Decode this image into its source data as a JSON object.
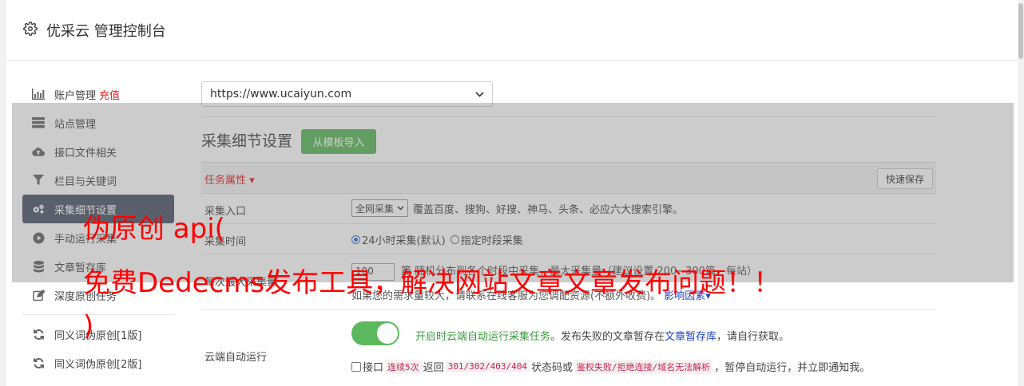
{
  "header": {
    "title": "优采云 管理控制台"
  },
  "sidebar": {
    "items": [
      {
        "label": "账户管理",
        "extra": "充值",
        "icon": "bar-chart-icon"
      },
      {
        "label": "站点管理",
        "icon": "server-icon"
      },
      {
        "label": "接口文件相关",
        "icon": "cloud-upload-icon"
      },
      {
        "label": "栏目与关键词",
        "icon": "filter-icon"
      },
      {
        "label": "采集细节设置",
        "icon": "gears-icon",
        "active": true
      },
      {
        "label": "手动运行采集",
        "icon": "play-circle-icon"
      },
      {
        "label": "文章暂存库",
        "icon": "database-icon"
      },
      {
        "label": "深度原创任务",
        "icon": "edit-icon"
      }
    ],
    "items2": [
      {
        "label": "同义词伪原创[1版]",
        "icon": "refresh-icon"
      },
      {
        "label": "同义词伪原创[2版]",
        "icon": "refresh-icon"
      }
    ]
  },
  "site_select": {
    "value": "https://www.ucaiyun.com"
  },
  "section": {
    "title": "采集细节设置",
    "import_button": "从模板导入"
  },
  "task_props": {
    "label": "任务属性 ▾",
    "save_button": "快速保存"
  },
  "rows": {
    "entry": {
      "label": "采集入口",
      "select": "全网采集",
      "desc": "覆盖百度、搜狗、好搜、神马、头条、必应六大搜索引擎。"
    },
    "time": {
      "label": "采集时间",
      "opt1": "24小时采集(默认)",
      "opt2": "指定时段采集"
    },
    "max": {
      "label": "每次最大采集量",
      "value": "100",
      "line1_unit": "篇",
      "line1_text": "随机分布到各个时段中采集，最大采集量（建议设置 200~300篇，每站）",
      "line2_text": "如果您的需求量较大，请联系在线客服为您调配资源(不额外收费)。",
      "line2_link": "影响因素▾"
    },
    "auto": {
      "label": "云端自动运行",
      "text_green": "开启时云端自动运行采集任务",
      "text_mid": "。发布失败的文章暂存在",
      "text_link": "文章暂存库",
      "text_end": "，请自行获取。",
      "cb_label": "接口",
      "code1": "连续5次",
      "mid1": "返回",
      "code2": "301/302/403/404",
      "mid2": "状态码或",
      "code3": "鉴权失败/拒绝连接/域名无法解析",
      "tail": "，暂停自动运行，并立即通知我。"
    }
  },
  "watermark": {
    "line1": "伪原创 api(",
    "line2": "免费Dedecms发布工具，解决网站文章文章发布问题！！",
    "line3": ")"
  },
  "colors": {
    "accent_green": "#5cb85c",
    "active_nav": "#505a6b",
    "red": "#e02020"
  }
}
